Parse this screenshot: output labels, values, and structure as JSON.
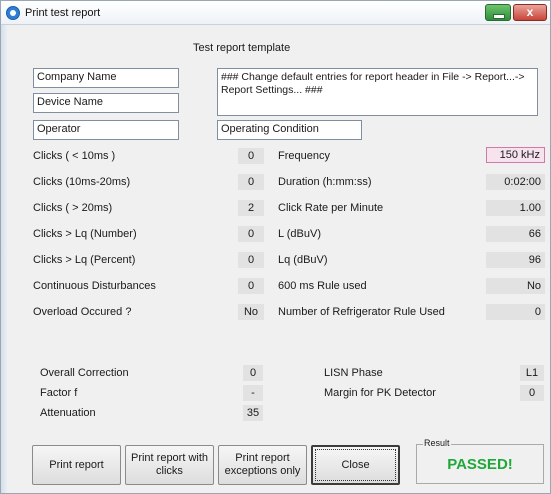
{
  "window": {
    "title": "Print test report",
    "close_glyph": "x"
  },
  "header": {
    "template_label": "Test report template"
  },
  "fields": {
    "company": "Company Name",
    "device": "Device Name",
    "operator": "Operator",
    "operating_condition": "Operating Condition",
    "header_note": "### Change default entries for report header in File -> Report...-> Report Settings... ###"
  },
  "left_rows": [
    {
      "label": "Clicks ( < 10ms )",
      "value": "0"
    },
    {
      "label": "Clicks (10ms-20ms)",
      "value": "0"
    },
    {
      "label": "Clicks ( > 20ms)",
      "value": "2"
    },
    {
      "label": "Clicks  > Lq (Number)",
      "value": "0"
    },
    {
      "label": "Clicks  > Lq (Percent)",
      "value": "0"
    },
    {
      "label": "Continuous Disturbances",
      "value": "0"
    },
    {
      "label": "Overload Occured ?",
      "value": "No"
    }
  ],
  "right_rows": [
    {
      "label": "Frequency",
      "value": "150 kHz"
    },
    {
      "label": "Duration (h:mm:ss)",
      "value": "0:02:00"
    },
    {
      "label": "Click Rate per Minute",
      "value": "1.00"
    },
    {
      "label": "L (dBuV)",
      "value": "66"
    },
    {
      "label": "Lq (dBuV)",
      "value": "96"
    },
    {
      "label": "600 ms Rule used",
      "value": "No"
    },
    {
      "label": "Number of Refrigerator Rule Used",
      "value": "0"
    }
  ],
  "lower_left": [
    {
      "label": "Overall Correction",
      "value": "0"
    },
    {
      "label": "Factor f",
      "value": "-"
    },
    {
      "label": "Attenuation",
      "value": "35"
    }
  ],
  "lower_right": [
    {
      "label": "LISN Phase",
      "value": "L1"
    },
    {
      "label": "Margin for PK Detector",
      "value": "0"
    }
  ],
  "buttons": {
    "print_report": "Print report",
    "print_with_clicks": "Print report with clicks",
    "print_exceptions": "Print report exceptions only",
    "close": "Close"
  },
  "result": {
    "legend": "Result",
    "status": "PASSED!",
    "status_color": "#20a83a"
  }
}
